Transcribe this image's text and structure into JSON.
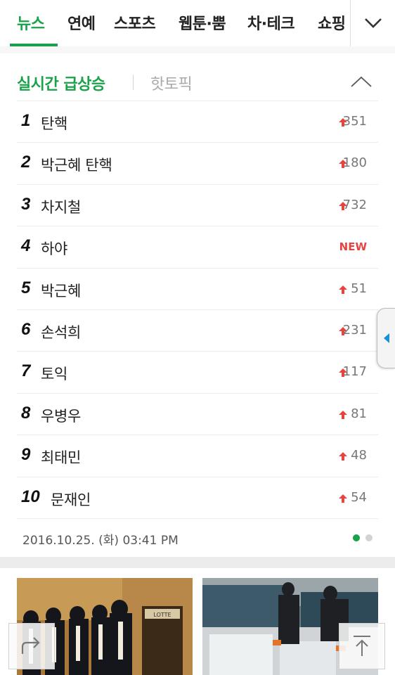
{
  "nav": {
    "tabs": [
      {
        "label": "뉴스",
        "active": true
      },
      {
        "label": "연예"
      },
      {
        "label": "스포츠"
      },
      {
        "label": "웹툰·뿜"
      },
      {
        "label": "차·테크"
      },
      {
        "label": "쇼핑"
      }
    ],
    "accent_color": "#1aa24a",
    "menu_icon": "chevron-down-icon"
  },
  "trending": {
    "tab_active": "실시간 급상승",
    "tab_inactive": "핫토픽",
    "collapse_icon": "chevron-up-icon",
    "items": [
      {
        "rank": "1",
        "keyword": "탄핵",
        "change": "351",
        "status": "up"
      },
      {
        "rank": "2",
        "keyword": "박근혜 탄핵",
        "change": "180",
        "status": "up"
      },
      {
        "rank": "3",
        "keyword": "차지철",
        "change": "732",
        "status": "up"
      },
      {
        "rank": "4",
        "keyword": "하야",
        "change": "NEW",
        "status": "new"
      },
      {
        "rank": "5",
        "keyword": "박근혜",
        "change": "51",
        "status": "up"
      },
      {
        "rank": "6",
        "keyword": "손석희",
        "change": "231",
        "status": "up"
      },
      {
        "rank": "7",
        "keyword": "토익",
        "change": "117",
        "status": "up"
      },
      {
        "rank": "8",
        "keyword": "우병우",
        "change": "81",
        "status": "up"
      },
      {
        "rank": "9",
        "keyword": "최태민",
        "change": "48",
        "status": "up"
      },
      {
        "rank": "10",
        "keyword": "문재인",
        "change": "54",
        "status": "up"
      }
    ],
    "up_color": "#e5453f",
    "timestamp": "2016.10.25. (화) 03:41 PM",
    "pager": {
      "total": 2,
      "current": 1
    }
  },
  "thumbnails": [
    {
      "sign_text": "LOTTE"
    },
    {}
  ],
  "floating": {
    "share_icon": "share-icon",
    "top_icon": "scroll-top-icon"
  }
}
